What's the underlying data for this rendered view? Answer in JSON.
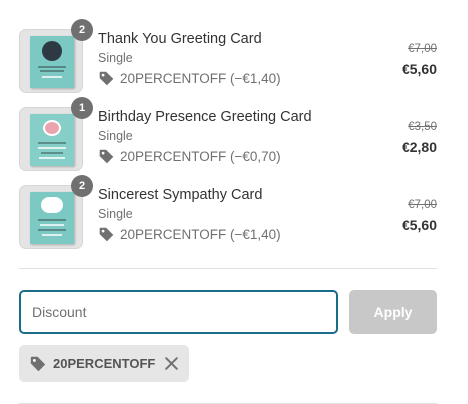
{
  "items": [
    {
      "quantity": "2",
      "name": "Thank You Greeting Card",
      "variant": "Single",
      "discount": "20PERCENTOFF (−€1,40)",
      "original_price": "€7,00",
      "final_price": "€5,60"
    },
    {
      "quantity": "1",
      "name": "Birthday Presence Greeting Card",
      "variant": "Single",
      "discount": "20PERCENTOFF (−€0,70)",
      "original_price": "€3,50",
      "final_price": "€2,80"
    },
    {
      "quantity": "2",
      "name": "Sincerest Sympathy Card",
      "variant": "Single",
      "discount": "20PERCENTOFF (−€1,40)",
      "original_price": "€7,00",
      "final_price": "€5,60"
    }
  ],
  "discount_form": {
    "placeholder": "Discount",
    "value": "",
    "apply_label": "Apply"
  },
  "applied_code": {
    "label": "20PERCENTOFF"
  },
  "icons": {
    "tag": "tag-icon",
    "remove": "close-icon"
  },
  "colors": {
    "focus_border": "#1a6c8a",
    "disabled_button": "#c8c8c8",
    "chip_background": "#e6e6e6"
  }
}
